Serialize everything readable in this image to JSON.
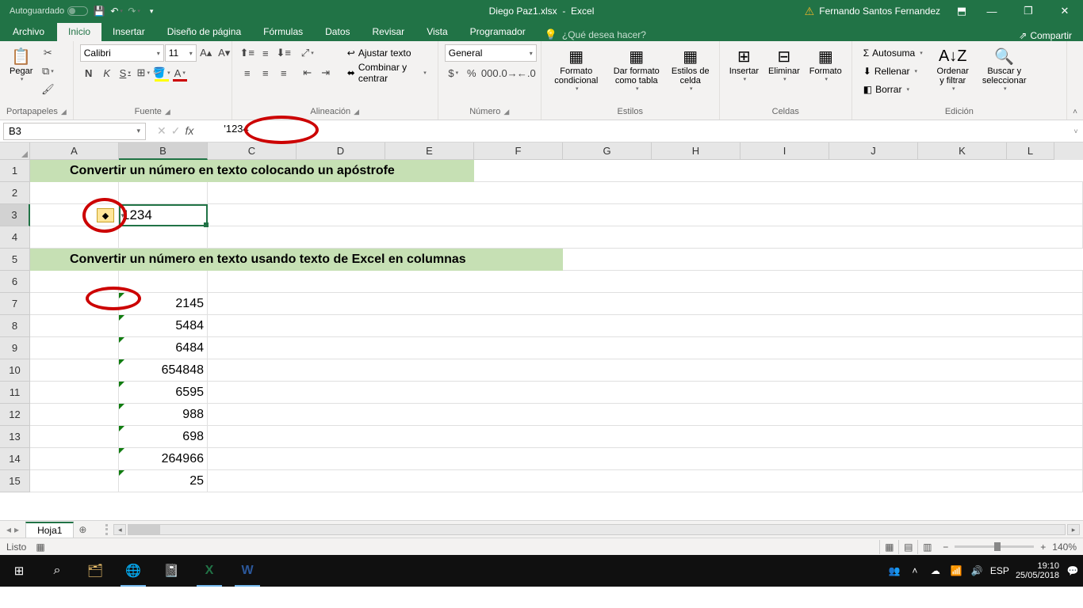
{
  "titlebar": {
    "autosave": "Autoguardado",
    "filename": "Diego Paz1.xlsx",
    "appname": "Excel",
    "user": "Fernando Santos Fernandez"
  },
  "tabs": {
    "file": "Archivo",
    "home": "Inicio",
    "insert": "Insertar",
    "pagelayout": "Diseño de página",
    "formulas": "Fórmulas",
    "data": "Datos",
    "review": "Revisar",
    "view": "Vista",
    "developer": "Programador",
    "tellme": "¿Qué desea hacer?",
    "share": "Compartir"
  },
  "ribbon": {
    "clipboard": {
      "label": "Portapapeles",
      "paste": "Pegar"
    },
    "font": {
      "label": "Fuente",
      "name": "Calibri",
      "size": "11"
    },
    "alignment": {
      "label": "Alineación",
      "wrap": "Ajustar texto",
      "merge": "Combinar y centrar"
    },
    "number": {
      "label": "Número",
      "format": "General"
    },
    "styles": {
      "label": "Estilos",
      "cond": "Formato condicional",
      "table": "Dar formato como tabla",
      "cell": "Estilos de celda"
    },
    "cells": {
      "label": "Celdas",
      "insert": "Insertar",
      "delete": "Eliminar",
      "format": "Formato"
    },
    "editing": {
      "label": "Edición",
      "autosum": "Autosuma",
      "fill": "Rellenar",
      "clear": "Borrar",
      "sort": "Ordenar y filtrar",
      "find": "Buscar y seleccionar"
    }
  },
  "formula_bar": {
    "cell_ref": "B3",
    "formula": "'1234"
  },
  "columns": [
    "A",
    "B",
    "C",
    "D",
    "E",
    "F",
    "G",
    "H",
    "I",
    "J",
    "K",
    "L"
  ],
  "rows_visible": 15,
  "cells": {
    "header1": "Convertir un número en texto colocando un apóstrofe",
    "b3": "1234",
    "header2": "Convertir un número en texto usando texto de Excel en columnas",
    "b7": "2145",
    "b8": "5484",
    "b9": "6484",
    "b10": "654848",
    "b11": "6595",
    "b12": "988",
    "b13": "698",
    "b14": "264966",
    "b15": "25"
  },
  "sheet_tabs": {
    "sheet1": "Hoja1"
  },
  "statusbar": {
    "ready": "Listo",
    "zoom": "140%"
  },
  "taskbar": {
    "lang": "ESP",
    "time": "19:10",
    "date": "25/05/2018"
  }
}
